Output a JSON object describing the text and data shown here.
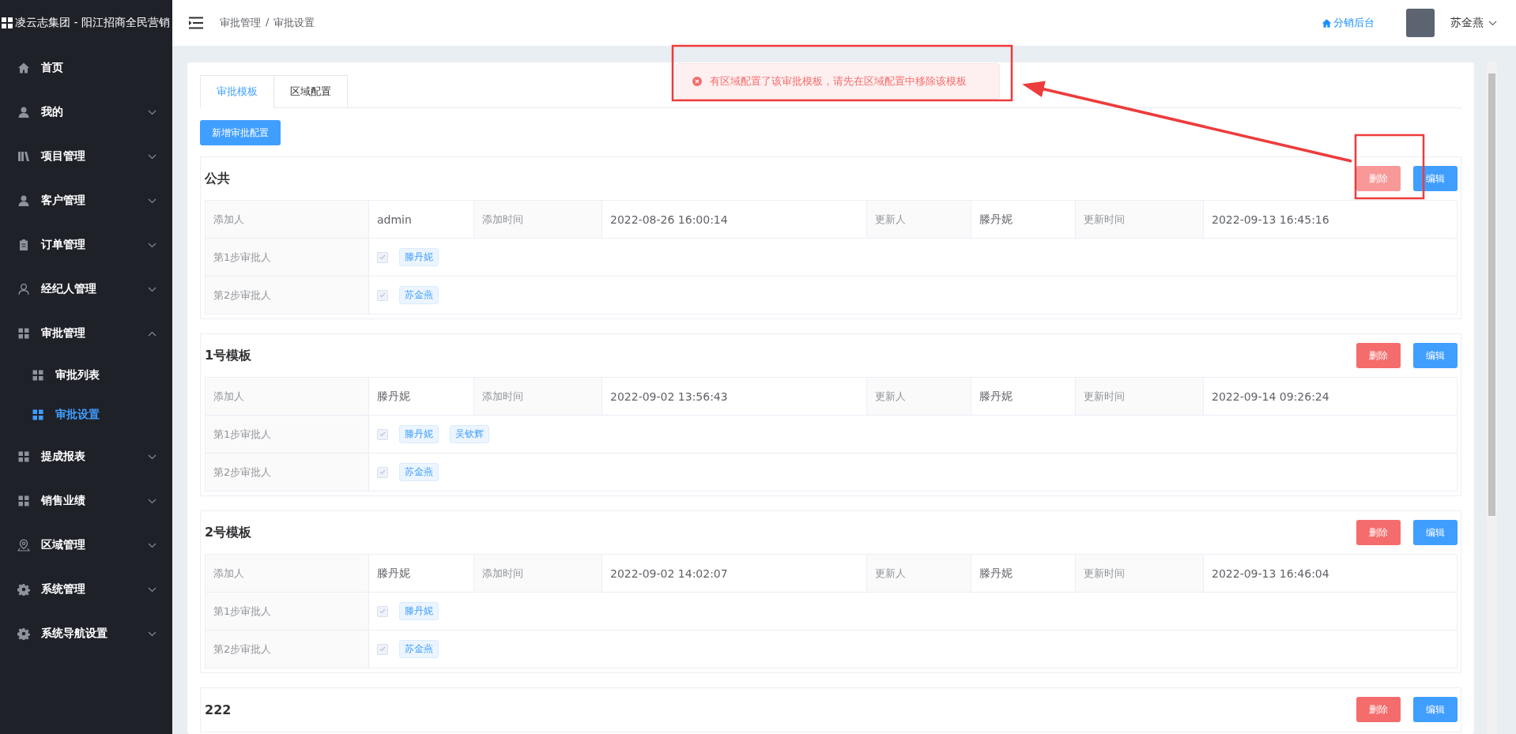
{
  "brand": {
    "title": "凌云志集团 - 阳江招商全民营销"
  },
  "sidebar": {
    "items": [
      {
        "label": "首页",
        "selected": false
      },
      {
        "label": "我的",
        "expanded": false,
        "selected": false
      },
      {
        "label": "项目管理",
        "expanded": false,
        "selected": false
      },
      {
        "label": "客户管理",
        "expanded": false,
        "selected": false
      },
      {
        "label": "订单管理",
        "expanded": false,
        "selected": false
      },
      {
        "label": "经纪人管理",
        "expanded": false,
        "selected": false
      },
      {
        "label": "审批管理",
        "expanded": true,
        "selected": false,
        "children": [
          {
            "label": "审批列表",
            "selected": false
          },
          {
            "label": "审批设置",
            "selected": true
          }
        ]
      },
      {
        "label": "提成报表",
        "expanded": false,
        "selected": false
      },
      {
        "label": "销售业绩",
        "expanded": false,
        "selected": false
      },
      {
        "label": "区域管理",
        "expanded": false,
        "selected": false
      },
      {
        "label": "系统管理",
        "expanded": false,
        "selected": false
      },
      {
        "label": "系统导航设置",
        "expanded": false,
        "selected": false
      }
    ]
  },
  "header": {
    "breadcrumb": [
      "审批管理",
      "审批设置"
    ],
    "breadcrumb_separator": "/",
    "link": "分销后台",
    "user": "苏金燕"
  },
  "toast": {
    "message": "有区域配置了该审批模板，请先在区域配置中移除该模板"
  },
  "tabs": [
    {
      "label": "审批模板",
      "selected": true
    },
    {
      "label": "区域配置",
      "selected": false
    }
  ],
  "add_button": "新增审批配置",
  "templates": [
    {
      "name": "公共",
      "delete": "删除",
      "edit": "编辑",
      "delete_hovered": true,
      "meta": [
        {
          "label": "添加人",
          "value": "admin"
        },
        {
          "label": "添加时间",
          "value": "2022-08-26 16:00:14"
        },
        {
          "label": "更新人",
          "value": "滕丹妮"
        },
        {
          "label": "更新时间",
          "value": "2022-09-13 16:45:16"
        }
      ],
      "steps": [
        {
          "label": "第1步审批人",
          "checked": true,
          "approvers": [
            "滕丹妮"
          ]
        },
        {
          "label": "第2步审批人",
          "checked": true,
          "approvers": [
            "苏金燕"
          ]
        }
      ]
    },
    {
      "name": "1号模板",
      "delete": "删除",
      "edit": "编辑",
      "delete_hovered": false,
      "meta": [
        {
          "label": "添加人",
          "value": "滕丹妮"
        },
        {
          "label": "添加时间",
          "value": "2022-09-02 13:56:43"
        },
        {
          "label": "更新人",
          "value": "滕丹妮"
        },
        {
          "label": "更新时间",
          "value": "2022-09-14 09:26:24"
        }
      ],
      "steps": [
        {
          "label": "第1步审批人",
          "checked": true,
          "approvers": [
            "滕丹妮",
            "吴钦辉"
          ]
        },
        {
          "label": "第2步审批人",
          "checked": true,
          "approvers": [
            "苏金燕"
          ]
        }
      ]
    },
    {
      "name": "2号模板",
      "delete": "删除",
      "edit": "编辑",
      "delete_hovered": false,
      "meta": [
        {
          "label": "添加人",
          "value": "滕丹妮"
        },
        {
          "label": "添加时间",
          "value": "2022-09-02 14:02:07"
        },
        {
          "label": "更新人",
          "value": "滕丹妮"
        },
        {
          "label": "更新时间",
          "value": "2022-09-13 16:46:04"
        }
      ],
      "steps": [
        {
          "label": "第1步审批人",
          "checked": true,
          "approvers": [
            "滕丹妮"
          ]
        },
        {
          "label": "第2步审批人",
          "checked": true,
          "approvers": [
            "苏金燕"
          ]
        }
      ]
    },
    {
      "name": "222",
      "delete": "删除",
      "edit": "编辑",
      "delete_hovered": false
    }
  ]
}
